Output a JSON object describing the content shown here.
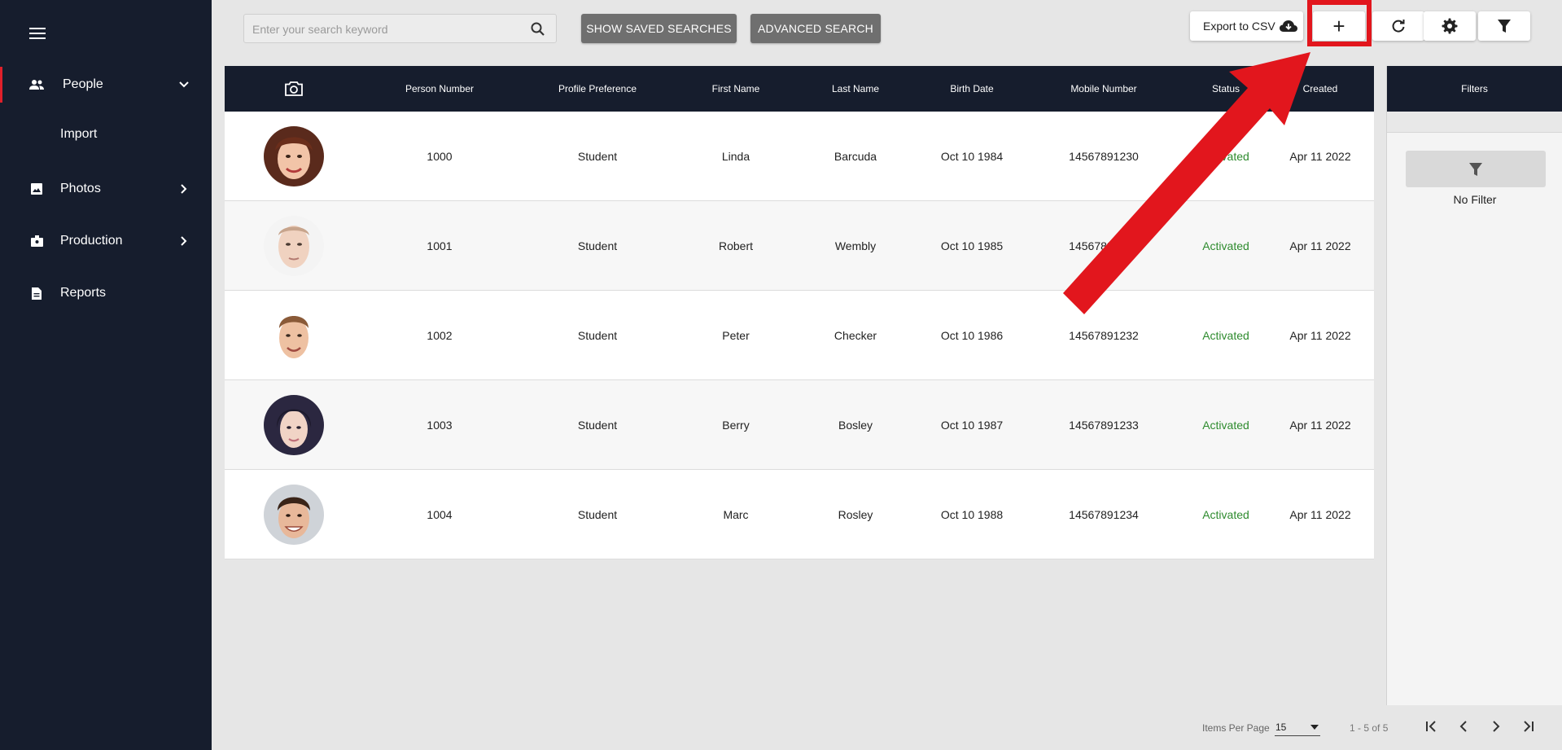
{
  "sidebar": {
    "items": [
      {
        "label": "People",
        "icon": "people-icon"
      },
      {
        "label": "Import"
      },
      {
        "label": "Photos",
        "icon": "image-icon"
      },
      {
        "label": "Production",
        "icon": "badge-icon"
      },
      {
        "label": "Reports",
        "icon": "document-icon"
      }
    ]
  },
  "toolbar": {
    "search_placeholder": "Enter your search keyword",
    "saved_searches_label": "SHOW SAVED SEARCHES",
    "advanced_search_label": "ADVANCED SEARCH",
    "export_label": "Export to CSV",
    "add_label": "+"
  },
  "table": {
    "columns": [
      "",
      "Person Number",
      "Profile Preference",
      "First Name",
      "Last Name",
      "Birth Date",
      "Mobile Number",
      "Status",
      "Created"
    ],
    "rows": [
      {
        "number": "1000",
        "profile": "Student",
        "first": "Linda",
        "last": "Barcuda",
        "birth": "Oct 10 1984",
        "mobile": "14567891230",
        "status": "Activated",
        "created": "Apr 11 2022"
      },
      {
        "number": "1001",
        "profile": "Student",
        "first": "Robert",
        "last": "Wembly",
        "birth": "Oct 10 1985",
        "mobile": "14567891231",
        "status": "Activated",
        "created": "Apr 11 2022"
      },
      {
        "number": "1002",
        "profile": "Student",
        "first": "Peter",
        "last": "Checker",
        "birth": "Oct 10 1986",
        "mobile": "14567891232",
        "status": "Activated",
        "created": "Apr 11 2022"
      },
      {
        "number": "1003",
        "profile": "Student",
        "first": "Berry",
        "last": "Bosley",
        "birth": "Oct 10 1987",
        "mobile": "14567891233",
        "status": "Activated",
        "created": "Apr 11 2022"
      },
      {
        "number": "1004",
        "profile": "Student",
        "first": "Marc",
        "last": "Rosley",
        "birth": "Oct 10 1988",
        "mobile": "14567891234",
        "status": "Activated",
        "created": "Apr 11 2022"
      }
    ]
  },
  "filters": {
    "title": "Filters",
    "empty_label": "No Filter"
  },
  "pagination": {
    "items_per_page_label": "Items Per Page",
    "items_per_page_value": "15",
    "range_label": "1 - 5 of 5"
  },
  "colors": {
    "sidebar_bg": "#161d2d",
    "accent_red": "#e2161d",
    "status_green": "#2e8b2e",
    "gray_button": "#6f6f6f"
  }
}
